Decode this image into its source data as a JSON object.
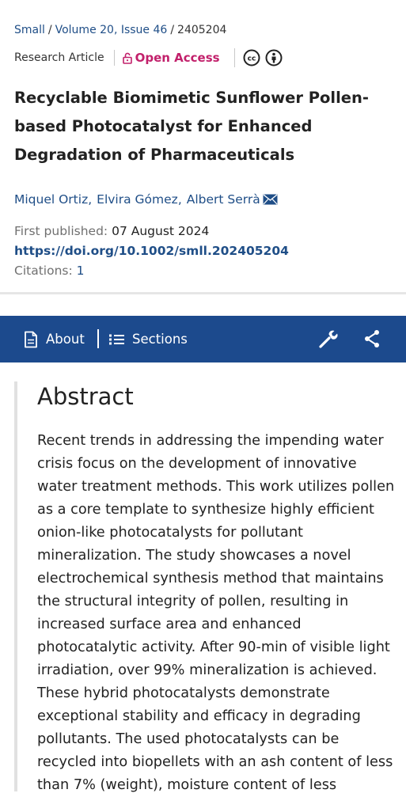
{
  "breadcrumb": {
    "journal": "Small",
    "volume_issue": "Volume 20, Issue 46",
    "separator": "/",
    "article_number": "2405204"
  },
  "meta": {
    "article_type": "Research Article",
    "open_access_label": "Open Access",
    "license_icons": [
      "creative-commons-icon",
      "attribution-icon"
    ]
  },
  "article": {
    "title": "Recyclable Biomimetic Sunflower Pollen-based Photocatalyst for Enhanced Degradation of Pharmaceuticals",
    "authors": [
      "Miquel Ortiz",
      "Elvira Gómez",
      "Albert Serrà"
    ],
    "first_published_label": "First published:",
    "first_published_date": "07 August 2024",
    "doi": "https://doi.org/10.1002/smll.202405204",
    "citations_label": "Citations:",
    "citations_count": "1"
  },
  "navbar": {
    "about_label": "About",
    "sections_label": "Sections",
    "tools_icon": "wrench-icon",
    "share_icon": "share-icon"
  },
  "abstract": {
    "heading": "Abstract",
    "text": "Recent trends in addressing the impending water crisis focus on the development of innovative water treatment methods. This work utilizes pollen as a core template to synthesize highly efficient onion-like photocatalysts for pollutant mineralization. The study showcases a novel electrochemical synthesis method that maintains the structural integrity of pollen, resulting in increased surface area and enhanced photocatalytic activity. After 90-min of visible light irradiation, over 99% mineralization is achieved. These hybrid photocatalysts demonstrate exceptional stability and efficacy in degrading pollutants. The used photocatalysts can be recycled into biopellets with an ash content of less than 7% (weight), moisture content of less"
  },
  "colors": {
    "link_blue": "#1f4e87",
    "open_access_pink": "#c2206b",
    "navbar_blue": "#1c4a8d"
  }
}
